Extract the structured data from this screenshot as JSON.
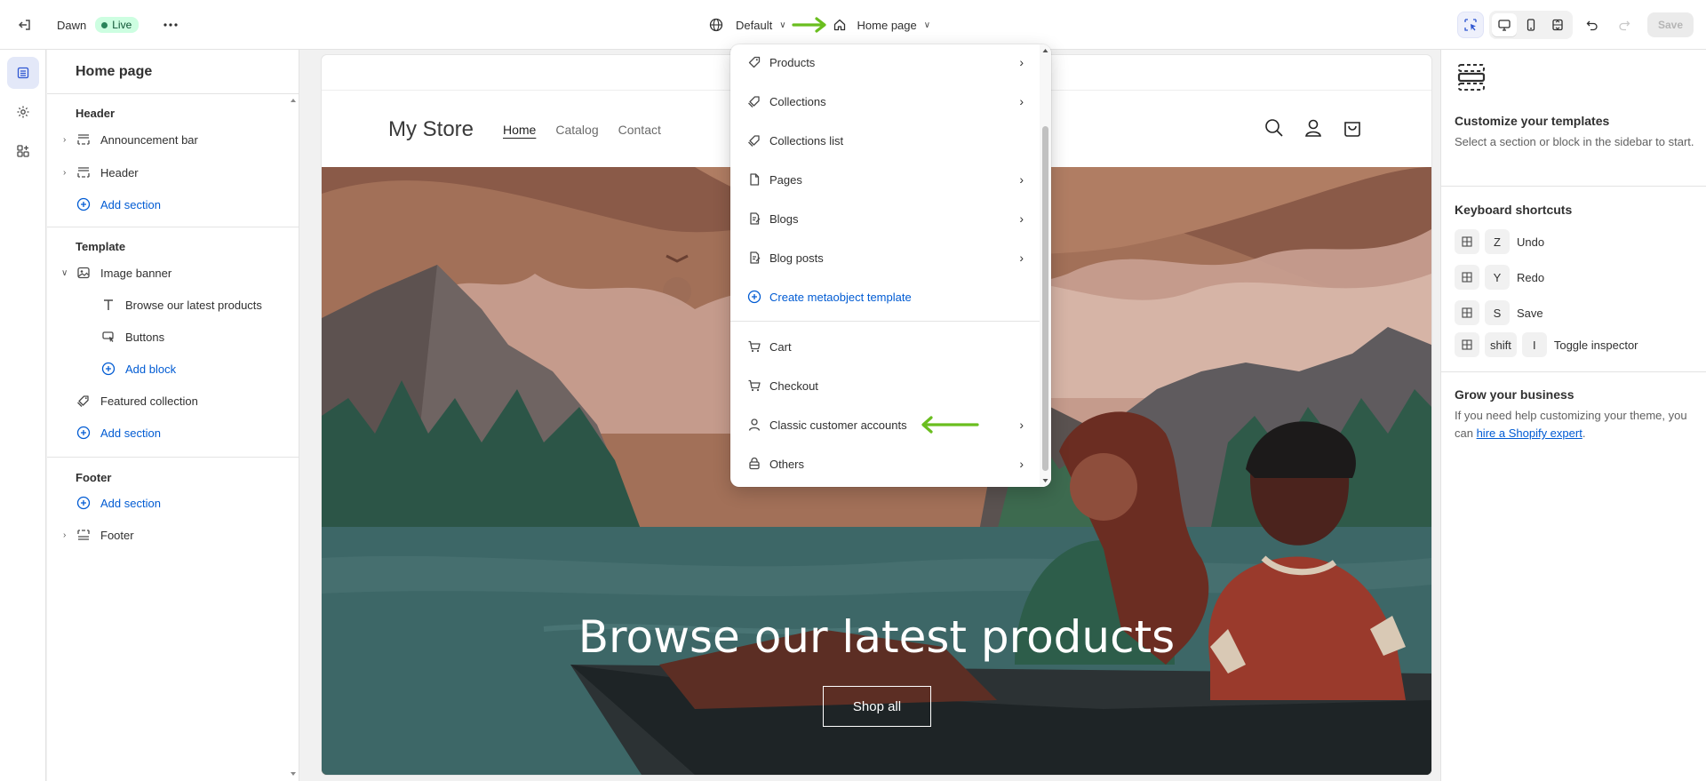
{
  "topbar": {
    "theme_name": "Dawn",
    "status_badge": "Live",
    "theme_selector": "Default",
    "page_selector": "Home page",
    "save_label": "Save"
  },
  "sidebar": {
    "title": "Home page",
    "groups": {
      "header": {
        "title": "Header",
        "items": [
          "Announcement bar",
          "Header"
        ],
        "add_label": "Add section"
      },
      "template": {
        "title": "Template",
        "banner": "Image banner",
        "blocks": [
          "Browse our latest products",
          "Buttons"
        ],
        "add_block": "Add block",
        "featured": "Featured collection",
        "add_label": "Add section"
      },
      "footer": {
        "title": "Footer",
        "add_label": "Add section",
        "item": "Footer"
      }
    }
  },
  "preview": {
    "store_name": "My Store",
    "nav": [
      "Home",
      "Catalog",
      "Contact"
    ],
    "banner_heading": "Browse our latest products",
    "banner_button": "Shop all"
  },
  "dropdown": {
    "items": [
      {
        "label": "Products",
        "icon": "tag-icon",
        "has_submenu": true
      },
      {
        "label": "Collections",
        "icon": "tags-icon",
        "has_submenu": true
      },
      {
        "label": "Collections list",
        "icon": "tags-icon",
        "has_submenu": false
      },
      {
        "label": "Pages",
        "icon": "page-icon",
        "has_submenu": true
      },
      {
        "label": "Blogs",
        "icon": "blog-icon",
        "has_submenu": true
      },
      {
        "label": "Blog posts",
        "icon": "blog-icon",
        "has_submenu": true
      },
      {
        "label": "Create metaobject template",
        "icon": "plus-circle-icon",
        "has_submenu": false
      },
      {
        "label": "Cart",
        "icon": "cart-icon",
        "has_submenu": false
      },
      {
        "label": "Checkout",
        "icon": "cart-icon",
        "has_submenu": false
      },
      {
        "label": "Classic customer accounts",
        "icon": "person-icon",
        "has_submenu": true
      },
      {
        "label": "Others",
        "icon": "others-icon",
        "has_submenu": true
      }
    ]
  },
  "rpanel": {
    "title": "Customize your templates",
    "desc": "Select a section or block in the sidebar to start.",
    "shortcuts_title": "Keyboard shortcuts",
    "shortcuts": [
      {
        "key": "Z",
        "label": "Undo"
      },
      {
        "key": "Y",
        "label": "Redo"
      },
      {
        "key": "S",
        "label": "Save"
      },
      {
        "key": "shift",
        "key2": "I",
        "label": "Toggle inspector"
      }
    ],
    "grow_title": "Grow your business",
    "grow_text": "If you need help customizing your theme, you can ",
    "grow_link": "hire a Shopify expert",
    "grow_end": "."
  },
  "colors": {
    "accent": "#005bd3",
    "live_badge": "#cdfee1",
    "annotation_arrow": "#6abe1f"
  }
}
